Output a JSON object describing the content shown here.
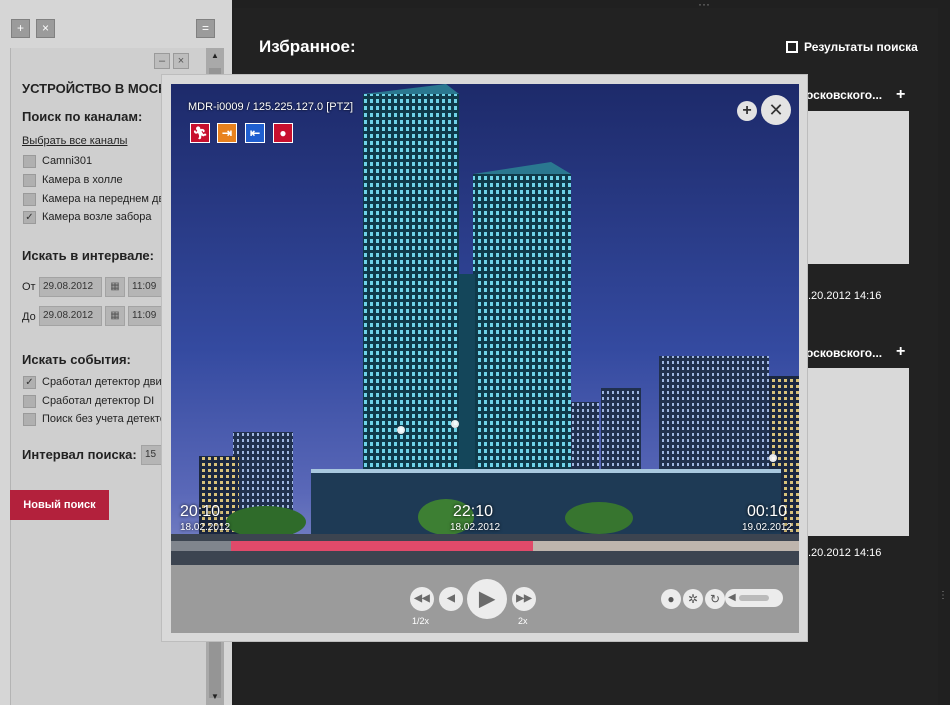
{
  "left_panel": {
    "panel_title": "УСТРОЙСТВО В МОСК",
    "channels": {
      "heading": "Поиск по каналам:",
      "select_all": "Выбрать все каналы",
      "items": [
        {
          "label": "Camni301",
          "checked": false
        },
        {
          "label": "Камера в холле",
          "checked": false
        },
        {
          "label": "Камера на переднем двор",
          "checked": false
        },
        {
          "label": "Камера возле забора",
          "checked": true
        }
      ]
    },
    "interval": {
      "heading": "Искать в интервале:",
      "from_label": "От",
      "to_label": "До",
      "from_date": "29.08.2012",
      "from_time": "11:09",
      "to_date": "29.08.2012",
      "to_time": "11:09"
    },
    "events": {
      "heading": "Искать события:",
      "items": [
        {
          "label": "Сработал детектор движ",
          "checked": true
        },
        {
          "label": "Сработал детектор DI",
          "checked": false
        },
        {
          "label": "Поиск без учета детекто",
          "checked": false
        }
      ]
    },
    "search_interval": {
      "label": "Интервал поиска:",
      "value": "15"
    },
    "new_search_label": "Новый поиск"
  },
  "main": {
    "title": "Избранное:",
    "results_link": "Результаты поиска",
    "cards": [
      {
        "title": "осковского...",
        "date": ".20.2012 14:16"
      },
      {
        "title": "осковского...",
        "date": ".20.2012 14:16"
      }
    ]
  },
  "player": {
    "camera_title": "MDR-i0009 / 125.225.127.0 [PTZ]",
    "event_icons": [
      {
        "name": "motion-icon",
        "color": "#c8102e"
      },
      {
        "name": "input-icon",
        "color": "#e8821e"
      },
      {
        "name": "output-icon",
        "color": "#1f5fd0"
      },
      {
        "name": "record-icon",
        "color": "#c8102e"
      }
    ],
    "timeline": {
      "start": {
        "time": "20:10",
        "date": "18.02.2012"
      },
      "current": {
        "time": "22:10",
        "date": "18.02.2012"
      },
      "end": {
        "time": "00:10",
        "date": "19.02.2012"
      }
    },
    "speed_slow": "1/2x",
    "speed_fast": "2x",
    "volume_level": 0.75
  }
}
